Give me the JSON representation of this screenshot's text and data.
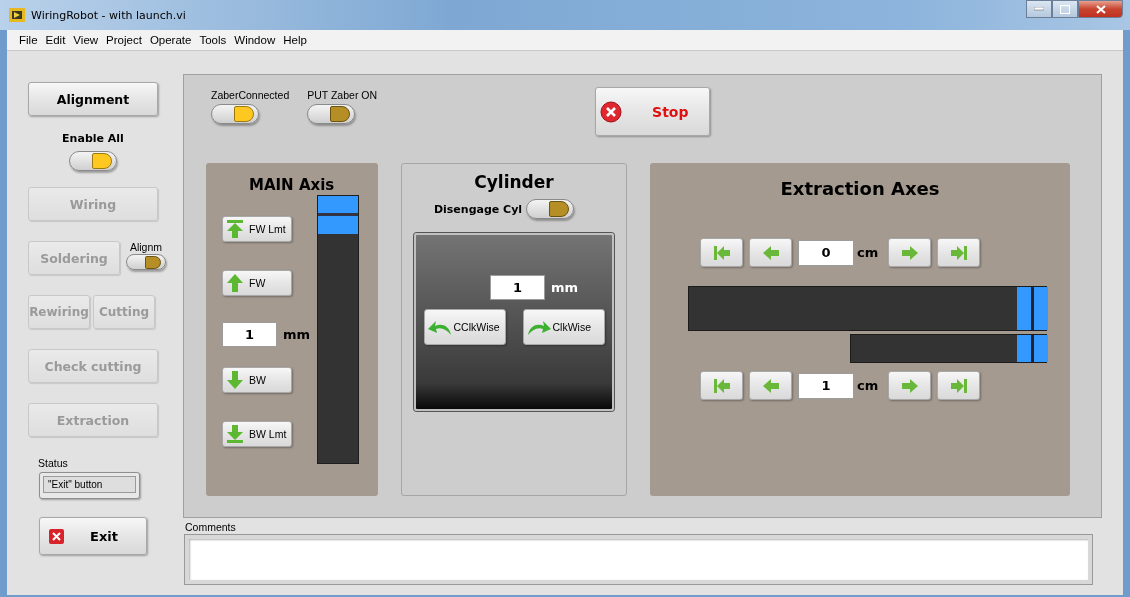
{
  "window": {
    "title": "WiringRobot - with launch.vi"
  },
  "menu": [
    "File",
    "Edit",
    "View",
    "Project",
    "Operate",
    "Tools",
    "Window",
    "Help"
  ],
  "sidebar": {
    "alignment_button": {
      "label": "Alignment",
      "disabled": false
    },
    "enable_all": {
      "label": "Enable All",
      "on": true
    },
    "wiring_button": {
      "label": "Wiring",
      "disabled": true
    },
    "soldering_button": {
      "label": "Soldering",
      "disabled": true
    },
    "alignm_toggle": {
      "label": "Alignm",
      "on": false
    },
    "rewiring_button": {
      "label": "Rewiring",
      "disabled": true
    },
    "cutting_button": {
      "label": "Cutting",
      "disabled": true
    },
    "check_cutting_button": {
      "label": "Check cutting",
      "disabled": true
    },
    "extraction_button": {
      "label": "Extraction",
      "disabled": true
    },
    "status": {
      "label": "Status",
      "value": "\"Exit\" button"
    },
    "exit_button": {
      "label": "Exit"
    }
  },
  "indicators": [
    {
      "label": "ZaberConnected",
      "on": true
    },
    {
      "label": "PUT Zaber ON",
      "on": false
    }
  ],
  "stop_button": {
    "label": "Stop"
  },
  "main_axis": {
    "title": "MAIN Axis",
    "forward_buttons": [
      {
        "label": "FW Lmt",
        "kind": "top"
      },
      {
        "label": "FW",
        "kind": "up"
      }
    ],
    "step": {
      "value": "1",
      "unit": "mm"
    },
    "back_buttons": [
      {
        "label": "BW",
        "kind": "down"
      },
      {
        "label": "BW Lmt",
        "kind": "bottom"
      }
    ],
    "slider": {
      "level": 1
    }
  },
  "cylinder": {
    "title": "Cylinder",
    "disengage": {
      "label": "Disengage Cyl",
      "on": false
    },
    "step": {
      "value": "1",
      "unit": "mm"
    },
    "buttons": [
      {
        "label": "CClkWise",
        "kind": "ccw"
      },
      {
        "label": "ClkWise",
        "kind": "cw"
      }
    ]
  },
  "extraction": {
    "title": "Extraction Axes",
    "axes": [
      {
        "value": "0",
        "unit": "cm",
        "level": 1
      },
      {
        "value": "1",
        "unit": "cm",
        "level": 1
      }
    ]
  },
  "comments": {
    "label": "Comments"
  }
}
